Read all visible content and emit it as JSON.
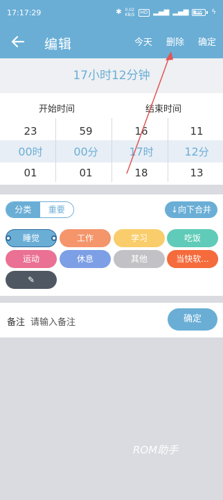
{
  "status_bar": {
    "time": "17:17:29",
    "icons": [
      "bluetooth-icon",
      "data-speed-icon",
      "hd-icon",
      "signal-icon",
      "signal-icon",
      "battery-icon",
      "charging-icon"
    ],
    "speed_text": "0.02 KB/S",
    "hd_text": "HD",
    "battery_text": "80",
    "battery_level": 0.8
  },
  "app_bar": {
    "title": "编辑",
    "today": "今天",
    "delete": "删除",
    "done": "确定"
  },
  "duration": "17小时12分钟",
  "picker": {
    "start_header": "开始时间",
    "end_header": "结束时间",
    "columns": [
      {
        "above": "23",
        "selected": "00",
        "unit": "时",
        "below": "01"
      },
      {
        "above": "59",
        "selected": "00",
        "unit": "分",
        "below": "01"
      },
      {
        "above": "16",
        "selected": "17",
        "unit": "时",
        "below": "18"
      },
      {
        "above": "11",
        "selected": "12",
        "unit": "分",
        "below": "13"
      }
    ]
  },
  "category": {
    "segment_categories": "分类",
    "segment_important": "重要",
    "merge_button": "↓向下合并",
    "chips": [
      {
        "label": "睡觉",
        "color": "#6aaed6",
        "selected": true
      },
      {
        "label": "工作",
        "color": "#f4956b"
      },
      {
        "label": "学习",
        "color": "#f9cd6b"
      },
      {
        "label": "吃饭",
        "color": "#5fcbb8"
      },
      {
        "label": "运动",
        "color": "#ea7193"
      },
      {
        "label": "休息",
        "color": "#7d9fe6"
      },
      {
        "label": "其他",
        "color": "#c2c2c6"
      },
      {
        "label": "当快软...",
        "color": "#f56b3b"
      }
    ],
    "edit_chip_icon": "pencil-icon"
  },
  "note": {
    "label": "备注",
    "placeholder": "请输入备注",
    "confirm": "确定"
  },
  "watermark": "ROM助手",
  "colors": {
    "primary": "#6aaed6",
    "annotation_arrow": "#e05555"
  }
}
